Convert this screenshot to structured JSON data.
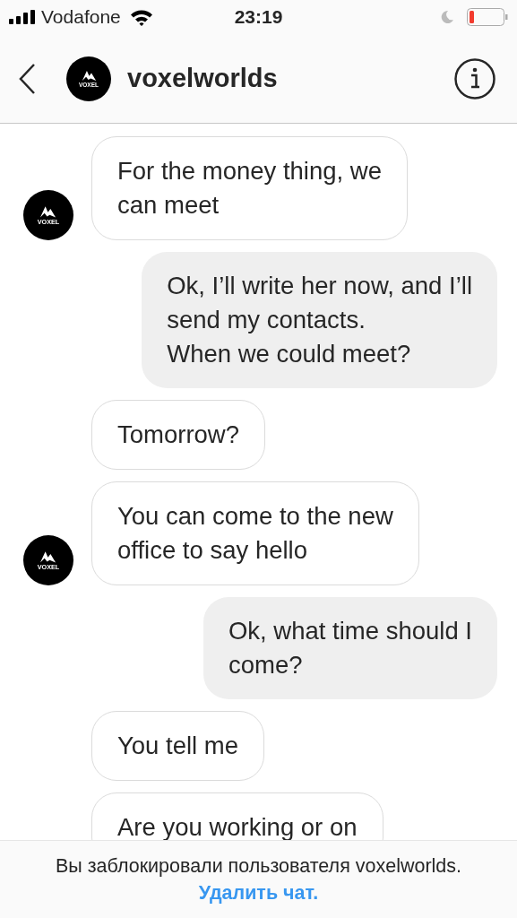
{
  "status_bar": {
    "carrier": "Vodafone",
    "time": "23:19"
  },
  "header": {
    "title": "voxelworlds",
    "avatar_label": "VOXEL"
  },
  "messages": [
    {
      "kind": "received",
      "text": "For the money thing, we\ncan meet",
      "avatar_label": "VOXEL"
    },
    {
      "kind": "sent",
      "text": "Ok, I’ll write her now, and I’ll\nsend my contacts.\nWhen we could meet?"
    },
    {
      "kind": "received",
      "text": "Tomorrow?"
    },
    {
      "kind": "received",
      "text": "You can come to the new\noffice to say hello",
      "avatar_label": "VOXEL"
    },
    {
      "kind": "sent",
      "text": "Ok, what time should I\ncome?"
    },
    {
      "kind": "received",
      "text": "You tell me"
    },
    {
      "kind": "received",
      "text": "Are you working or on"
    }
  ],
  "banner": {
    "text": "Вы заблокировали пользователя voxelworlds.",
    "link": "Удалить чат."
  }
}
